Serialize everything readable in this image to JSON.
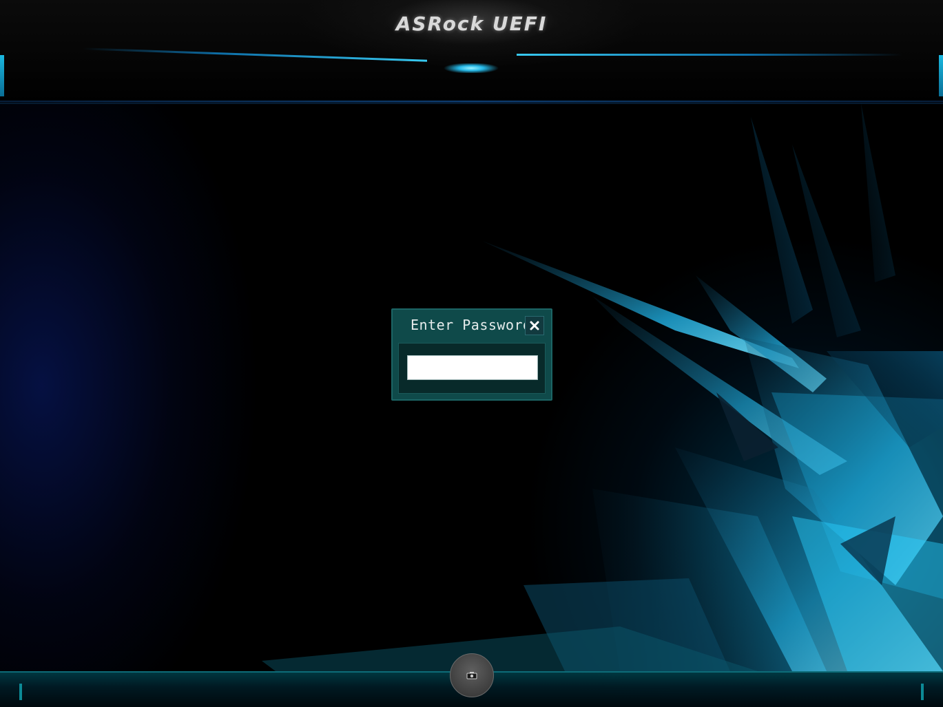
{
  "header": {
    "logo_text": "ASRock UEFI"
  },
  "dialog": {
    "title": "Enter Password",
    "close_icon": "close-icon",
    "password_value": "",
    "password_placeholder": ""
  },
  "footer": {
    "screenshot_icon": "camera-icon"
  },
  "colors": {
    "accent": "#2bc0e8",
    "dialog_bg": "#0f4a4a",
    "header_bg": "#0b0b0b"
  }
}
